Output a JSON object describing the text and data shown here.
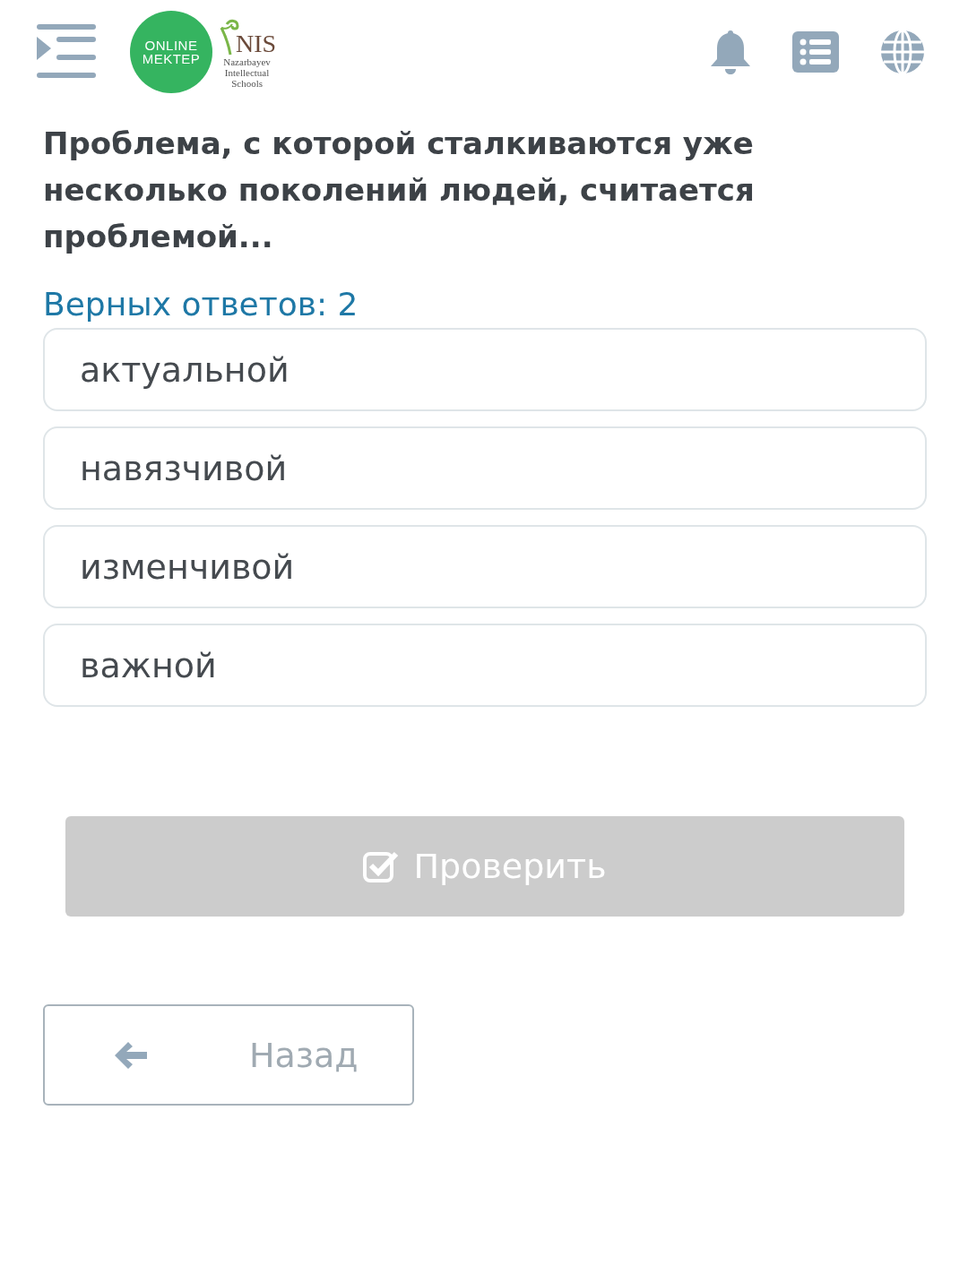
{
  "header": {
    "logo": {
      "line_1": "ONLINE",
      "line_2": "MEKTEP"
    },
    "partner_logo": {
      "name": "NIS",
      "line_1": "Nazarbayev",
      "line_2": "Intellectual",
      "line_3": "Schools"
    }
  },
  "question": "Проблема, с которой сталкиваются уже несколько поколений людей, считается проблемой...",
  "answer_count": "Верных ответов: 2",
  "options": [
    {
      "label": "актуальной",
      "selected": false
    },
    {
      "label": "навязчивой",
      "selected": false
    },
    {
      "label": "изменчивой",
      "selected": false
    },
    {
      "label": "важной",
      "selected": false
    }
  ],
  "check_button": {
    "label": "Проверить",
    "disabled": true
  },
  "back_button": {
    "label": "Назад"
  }
}
